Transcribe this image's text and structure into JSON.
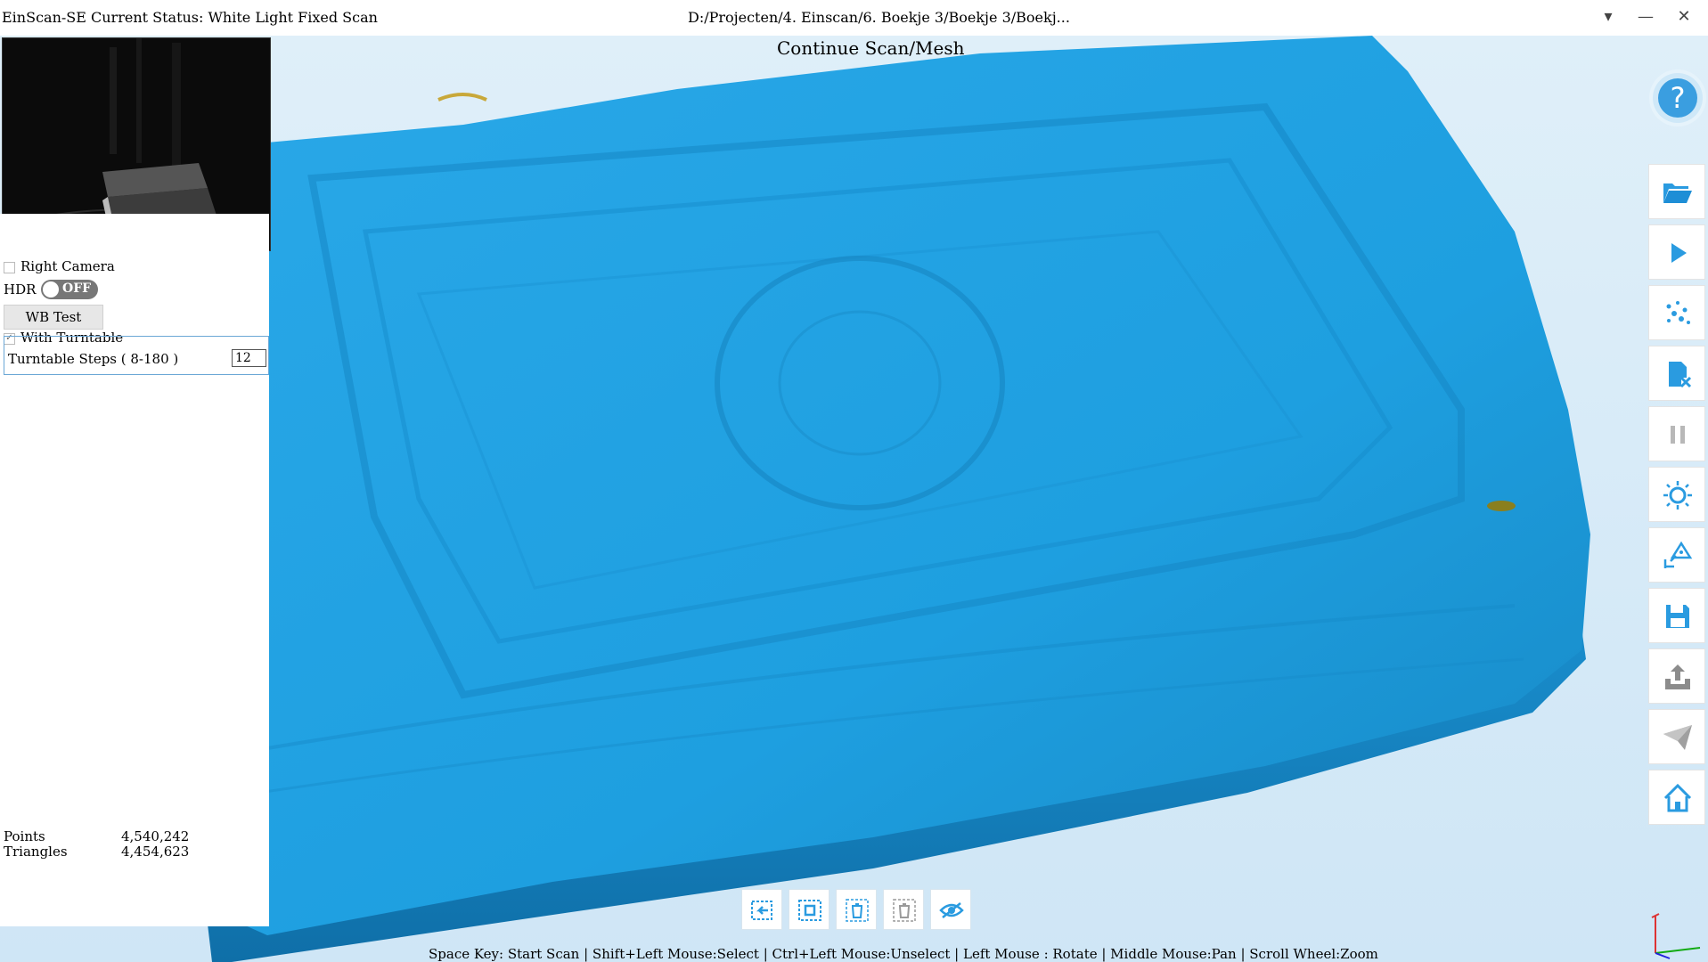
{
  "window": {
    "title": "EinScan-SE Current Status: White Light Fixed Scan",
    "path": "D:/Projecten/4. Einscan/6. Boekje 3/Boekje 3/Boekj...",
    "controls": [
      "▾",
      "—",
      "✕"
    ]
  },
  "viewport": {
    "title": "Continue Scan/Mesh",
    "model_color": "#1e9fe0"
  },
  "left_panel": {
    "right_camera_label": "Right Camera",
    "hdr_label": "HDR",
    "hdr_state": "OFF",
    "wb_test_label": "WB Test",
    "with_turntable_label": "With Turntable",
    "turntable_steps_label": "Turntable Steps ( 8-180 )",
    "turntable_steps_value": "12",
    "zoom_icon": "🔍"
  },
  "stats": {
    "points_label": "Points",
    "points_value": "4,540,242",
    "triangles_label": "Triangles",
    "triangles_value": "4,454,623"
  },
  "help": {
    "label": "?"
  },
  "right_toolbar": [
    {
      "icon": "open-folder-icon"
    },
    {
      "icon": "play-icon"
    },
    {
      "icon": "points-icon"
    },
    {
      "icon": "delete-file-icon"
    },
    {
      "icon": "pause-icon"
    },
    {
      "icon": "brightness-icon"
    },
    {
      "icon": "align-icon"
    },
    {
      "icon": "save-icon"
    },
    {
      "icon": "export-icon"
    },
    {
      "icon": "share-icon"
    },
    {
      "icon": "home-icon"
    }
  ],
  "bottom_toolbar": [
    {
      "icon": "undo-select-icon"
    },
    {
      "icon": "select-all-icon"
    },
    {
      "icon": "delete-selection-icon"
    },
    {
      "icon": "delete-unselected-icon"
    },
    {
      "icon": "visibility-icon"
    }
  ],
  "hint_text": "Space Key: Start Scan | Shift+Left Mouse:Select | Ctrl+Left Mouse:Unselect | Left Mouse : Rotate | Middle Mouse:Pan | Scroll Wheel:Zoom",
  "accent_color": "#1e9fe0"
}
